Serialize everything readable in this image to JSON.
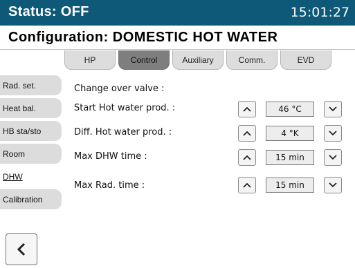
{
  "status": {
    "label": "Status: OFF",
    "time": "15:01:27"
  },
  "title": "Configuration: DOMESTIC HOT WATER",
  "tabs": [
    {
      "label": "HP",
      "active": false
    },
    {
      "label": "Control",
      "active": true
    },
    {
      "label": "Auxiliary",
      "active": false
    },
    {
      "label": "Comm.",
      "active": false
    },
    {
      "label": "EVD",
      "active": false
    }
  ],
  "sidebar": [
    {
      "label": "Rad. set.",
      "active": false
    },
    {
      "label": "Heat bal.",
      "active": false
    },
    {
      "label": "HB sta/sto",
      "active": false
    },
    {
      "label": "Room",
      "active": false
    },
    {
      "label": "DHW",
      "active": true
    },
    {
      "label": "Calibration",
      "active": false
    }
  ],
  "settings": {
    "change_over_label": "Change over valve :",
    "rows": [
      {
        "label": "Start Hot water prod. :",
        "value": "46 °C"
      },
      {
        "label": "Diff. Hot water prod. :",
        "value": "4 °K"
      },
      {
        "label": "Max DHW time :",
        "value": "15 min"
      },
      {
        "label": "Max Rad. time :",
        "value": "15 min"
      }
    ]
  },
  "icons": {
    "up": "chevron-up-icon",
    "down": "chevron-down-icon",
    "back": "chevron-left-icon"
  },
  "colors": {
    "status_bar": "#0e5878",
    "tab_active": "#7e7e7e",
    "tab_inactive": "#dddddd"
  }
}
